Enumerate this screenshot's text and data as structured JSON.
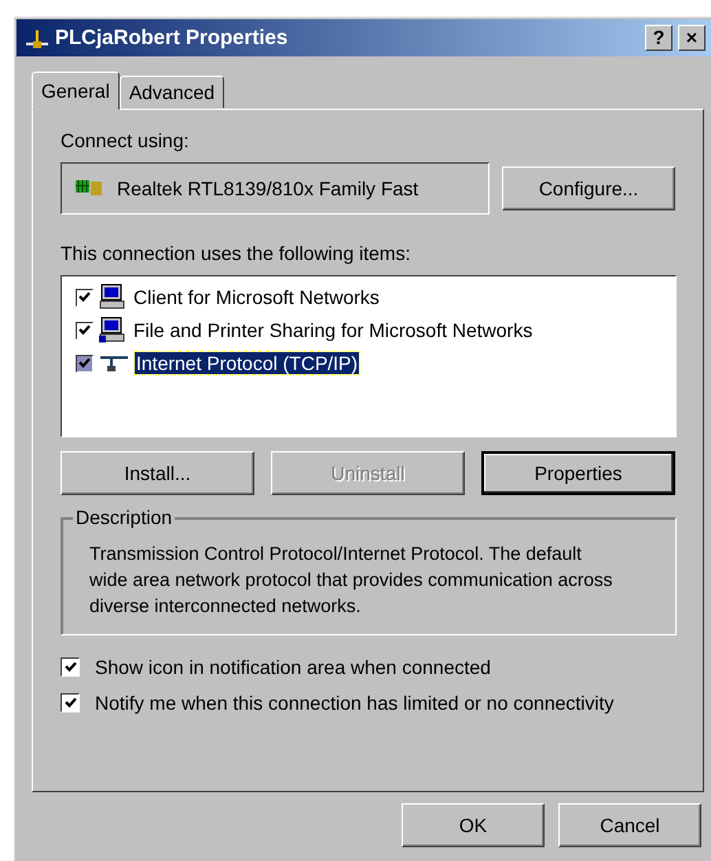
{
  "window": {
    "title": "PLCjaRobert Properties",
    "help_button": "?",
    "close_button": "×"
  },
  "tabs": [
    {
      "label": "General",
      "selected": true
    },
    {
      "label": "Advanced",
      "selected": false
    }
  ],
  "connect_using": {
    "label": "Connect using:",
    "adapter": "Realtek RTL8139/810x Family Fast",
    "configure_button": {
      "label": "Configure..."
    }
  },
  "items_label": {
    "text": "This connection uses the following items:"
  },
  "items": [
    {
      "label": "Client for Microsoft Networks",
      "checked": true,
      "selected": false,
      "kind": "client"
    },
    {
      "label": "File and Printer Sharing for Microsoft Networks",
      "checked": true,
      "selected": false,
      "kind": "service"
    },
    {
      "label": "Internet Protocol (TCP/IP)",
      "checked": true,
      "selected": true,
      "kind": "protocol"
    }
  ],
  "item_buttons": [
    {
      "label": "Install...",
      "disabled": false,
      "default": false
    },
    {
      "label": "Uninstall",
      "disabled": true,
      "default": false
    },
    {
      "label": "Properties",
      "disabled": false,
      "default": true
    }
  ],
  "description": {
    "title": "Description",
    "text": "Transmission Control Protocol/Internet Protocol. The default wide area network protocol that provides communication across diverse interconnected networks."
  },
  "options": [
    {
      "label": "Show icon in notification area when connected",
      "checked": true
    },
    {
      "label": "Notify me when this connection has limited or no connectivity",
      "checked": true
    }
  ],
  "dialog_buttons": [
    {
      "label": "OK",
      "default": false
    },
    {
      "label": "Cancel",
      "default": false
    }
  ]
}
